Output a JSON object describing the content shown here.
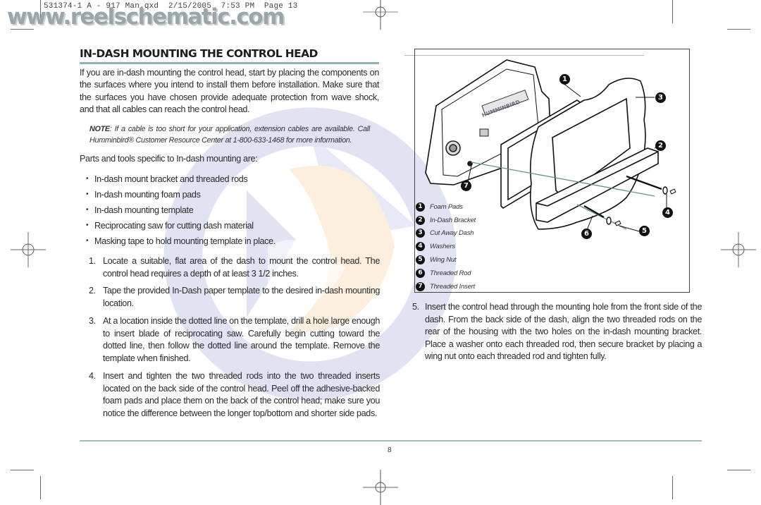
{
  "slug": {
    "text": "531374-1 A - 917 Man.qxd  2/15/2005  7:53 PM  Page 13"
  },
  "watermark": {
    "site": "www.reelschematic.com"
  },
  "section": {
    "title": "IN-DASH MOUNTING THE CONTROL HEAD",
    "intro": "If you are in-dash mounting the control head, start by placing the components on the surfaces where you intend to install them before installation. Make sure that the surfaces you have chosen provide adequate protection from wave shock, and that all cables can reach the control head.",
    "note_label": "NOTE",
    "note_text": ": If a cable is too short for your application, extension cables are available. Call Humminbird® Customer Resource Center at 1-800-633-1468 for more information.",
    "parts_intro": "Parts and tools specific to In-dash mounting are:",
    "parts": [
      "In-dash mount bracket and threaded rods",
      "In-dash mounting foam pads",
      "In-dash mounting template",
      "Reciprocating saw for cutting dash material",
      "Masking tape to hold mounting template in place."
    ],
    "steps": [
      {
        "num": "1.",
        "text": "Locate a suitable, flat area of the dash to mount the control head.  The control head requires a depth of at least 3 1/2 inches."
      },
      {
        "num": "2.",
        "text": "Tape the provided In-Dash paper template to the desired in-dash mounting location."
      },
      {
        "num": "3.",
        "text": "At a location inside the dotted line on the template, drill a hole large enough to insert blade of reciprocating saw. Carefully begin cutting toward the dotted line, then follow the dotted line around the template. Remove the template when finished."
      },
      {
        "num": "4.",
        "text": "Insert and tighten the two threaded rods into the two threaded inserts located on the back side of the control head. Peel off the adhesive-backed foam pads and place them on the back of the control head; make sure you notice the difference between the longer top/bottom and shorter side pads."
      },
      {
        "num": "5.",
        "text": "Insert the control head through the mounting hole from the front side of the dash. From the back side of the dash, align the two threaded rods on the rear of the housing with the two holes on the in-dash mounting bracket. Place a washer onto each threaded rod, then secure bracket by placing a wing nut onto each threaded rod and tighten fully."
      }
    ]
  },
  "figure": {
    "brand_label": "HUMMINBIRD",
    "legend": [
      {
        "n": "1",
        "label": "Foam Pads"
      },
      {
        "n": "2",
        "label": "In-Dash Bracket"
      },
      {
        "n": "3",
        "label": "Cut Away Dash"
      },
      {
        "n": "4",
        "label": "Washers"
      },
      {
        "n": "5",
        "label": "Wing Nut"
      },
      {
        "n": "6",
        "label": "Threaded Rod"
      },
      {
        "n": "7",
        "label": "Threaded Insert"
      }
    ],
    "callouts": [
      "1",
      "2",
      "3",
      "4",
      "5",
      "6",
      "7"
    ]
  },
  "footer": {
    "page_number": "8"
  },
  "colors": {
    "rule": "#8fb2b3",
    "watermark_blue": "#c9cdea",
    "watermark_orange": "#fbe3c3"
  }
}
